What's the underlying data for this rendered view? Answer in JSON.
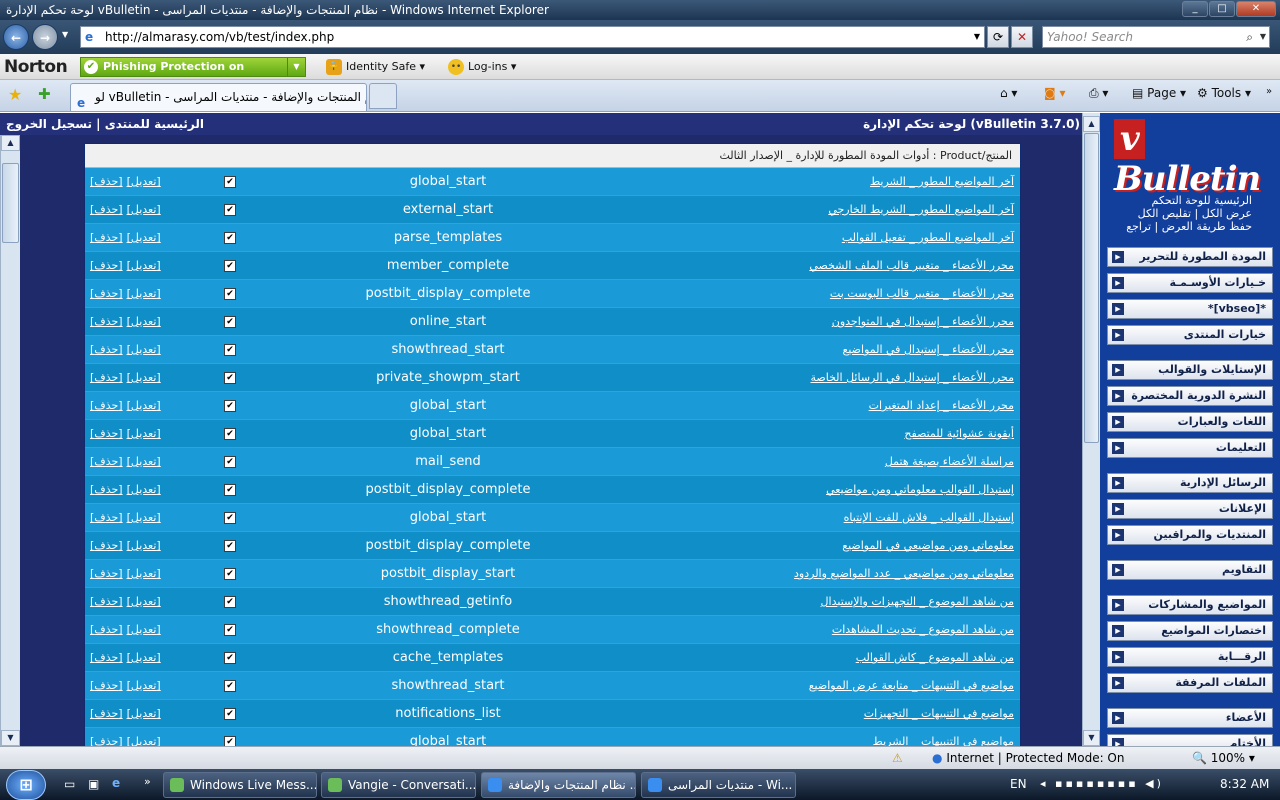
{
  "window": {
    "title": "لوحة تحكم الإدارة vBulletin - نظام المنتجات والإضافة - منتديات المراسى - Windows Internet Explorer"
  },
  "address": {
    "url": "http://almarasy.com/vb/test/index.php",
    "search_placeholder": "Yahoo! Search"
  },
  "norton": {
    "brand": "Norton",
    "phishing": "Phishing Protection on",
    "identity": "Identity Safe",
    "logins": "Log-ins"
  },
  "tab": {
    "title": "لو vBulletin - نظام المنتجات والإضافة - منتديات المراسى"
  },
  "commands": {
    "page": "Page",
    "tools": "Tools"
  },
  "cp": {
    "header_right": "لوحة تحكم الإدارة (vBulletin 3.7.0)",
    "header_left": "الرئيسية للمنتدى | تسجيل الخروج",
    "product_header": "المنتج/Product : أدوات المودة المطورة للإدارة _ الإصدار الثالث",
    "edit_label": "[تعديل]",
    "delete_label": "[حذف]",
    "check_mark": "✔",
    "rows": [
      {
        "name": "آخر المواضيع المطور _ الشريط",
        "hook": "global_start"
      },
      {
        "name": "آخر المواضيع المطور _ الشريط الخارجي",
        "hook": "external_start"
      },
      {
        "name": "آخر المواضيع المطور _ تفعيل القوالب",
        "hook": "parse_templates"
      },
      {
        "name": "محرر الأعضاء _ متغيير قالب الملف الشخصي",
        "hook": "member_complete"
      },
      {
        "name": "محرر الأعضاء _ متغيير قالب البوست بت",
        "hook": "postbit_display_complete"
      },
      {
        "name": "محرر الأعضاء _ إستبدال في المتواجدون",
        "hook": "online_start"
      },
      {
        "name": "محرر الأعضاء _ إستبدال في المواضيع",
        "hook": "showthread_start"
      },
      {
        "name": "محرر الأعضاء _ إستبدال في الرسائل الخاصة",
        "hook": "private_showpm_start"
      },
      {
        "name": "محرر الأعضاء _ إعداد المتغيرات",
        "hook": "global_start"
      },
      {
        "name": "أيقونة عشوائية للمتصفح",
        "hook": "global_start"
      },
      {
        "name": "مراسلة الأعضاء بصيغة هتمل",
        "hook": "mail_send"
      },
      {
        "name": "إستبدال القوالب معلوماتي ومن مواضيعي",
        "hook": "postbit_display_complete"
      },
      {
        "name": "إستبدال القوالب _ فلاش للفت الإنتباه",
        "hook": "global_start"
      },
      {
        "name": "معلوماتي ومن مواضيعي في المواضيع",
        "hook": "postbit_display_complete"
      },
      {
        "name": "معلوماتي ومن مواضيعي _ عدد المواضيع والردود",
        "hook": "postbit_display_start"
      },
      {
        "name": "من شاهد الموضوع _ التجهيزات والإستبدال",
        "hook": "showthread_getinfo"
      },
      {
        "name": "من شاهد الموضوع _ تحديث المشاهدات",
        "hook": "showthread_complete"
      },
      {
        "name": "من شاهد الموضوع _ كاش القوالب",
        "hook": "cache_templates"
      },
      {
        "name": "مواضيع في التنبيهات _ متابعة عرض المواضيع",
        "hook": "showthread_start"
      },
      {
        "name": "مواضيع في التنبيهات _ التجهيزات",
        "hook": "notifications_list"
      },
      {
        "name": "مواضيع في التنبيهات _ الشريط",
        "hook": "global_start"
      }
    ]
  },
  "sidebar": {
    "logo_text": "Bulletin",
    "logo_v": "v",
    "links": [
      "الرئيسية للوحة التحكم",
      "عرض الكل | تقليص الكل",
      "حفظ طريقة العرض | تراجع"
    ],
    "menus": [
      "المودة المطورة للتحرير",
      "خـيارات الأوسـمـة",
      "*[vbseo]*",
      "خيارات المنتدى",
      "الإستايلات والقوالب",
      "النشرة الدورية المختصرة",
      "اللغات والعبارات",
      "التعليمات",
      "الرسائل الإدارية",
      "الإعلانات",
      "المنتديات والمراقبين",
      "التقاويم",
      "المواضيع والمشاركات",
      "اختصارات المواضيع",
      "الرقـــابة",
      "الملفات المرفقة",
      "الأعضاء",
      "الأختام"
    ]
  },
  "status": {
    "zone": "Internet | Protected Mode: On",
    "zoom": "100%"
  },
  "taskbar": {
    "buttons": [
      "Windows Live Mess...",
      "Vangie - Conversati...",
      "نظام المنتجات والإضافة ...",
      "منتديات المراسى - Wi..."
    ],
    "lang": "EN",
    "time": "8:32 AM"
  }
}
